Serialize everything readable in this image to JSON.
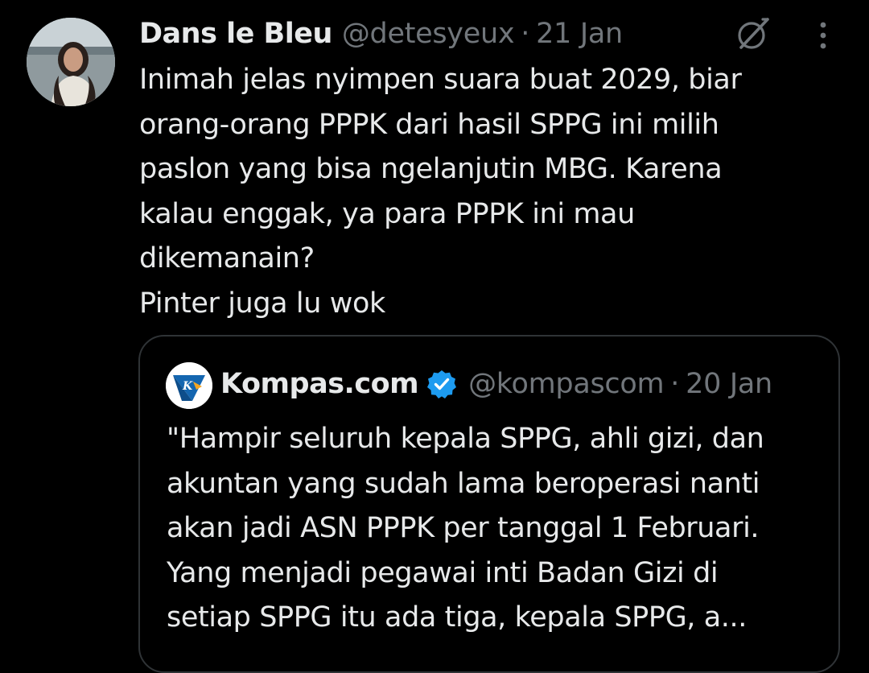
{
  "tweet": {
    "author": {
      "display_name": "Dans le Bleu",
      "handle": "@detesyeux",
      "avatar_icon": "user-avatar"
    },
    "separator": "·",
    "date": "21 Jan",
    "lines": [
      "Inimah jelas nyimpen suara buat 2029, biar",
      "orang-orang PPPK dari hasil SPPG ini milih",
      "paslon yang bisa ngelanjutin MBG. Karena",
      "kalau enggak, ya para PPPK ini mau",
      "dikemanain?",
      "Pinter juga lu wok"
    ],
    "icons": {
      "grok": "grok-icon",
      "more": "more-vertical-icon"
    }
  },
  "quote": {
    "author": {
      "display_name": "Kompas.com",
      "handle": "@kompascom",
      "verified": true,
      "avatar_icon": "kompas-logo"
    },
    "separator": "·",
    "date": "20 Jan",
    "lines": [
      "\"Hampir seluruh kepala SPPG, ahli gizi, dan",
      "akuntan yang sudah lama beroperasi nanti",
      "akan jadi ASN PPPK per tanggal 1 Februari.",
      "Yang menjadi pegawai inti Badan Gizi di",
      "setiap SPPG itu ada tiga, kepala SPPG, a..."
    ]
  },
  "colors": {
    "background": "#000000",
    "text_primary": "#e7e9ea",
    "text_secondary": "#71767b",
    "border": "#2f3336",
    "verified": "#1d9bf0",
    "kompas_blue": "#1466b0"
  }
}
